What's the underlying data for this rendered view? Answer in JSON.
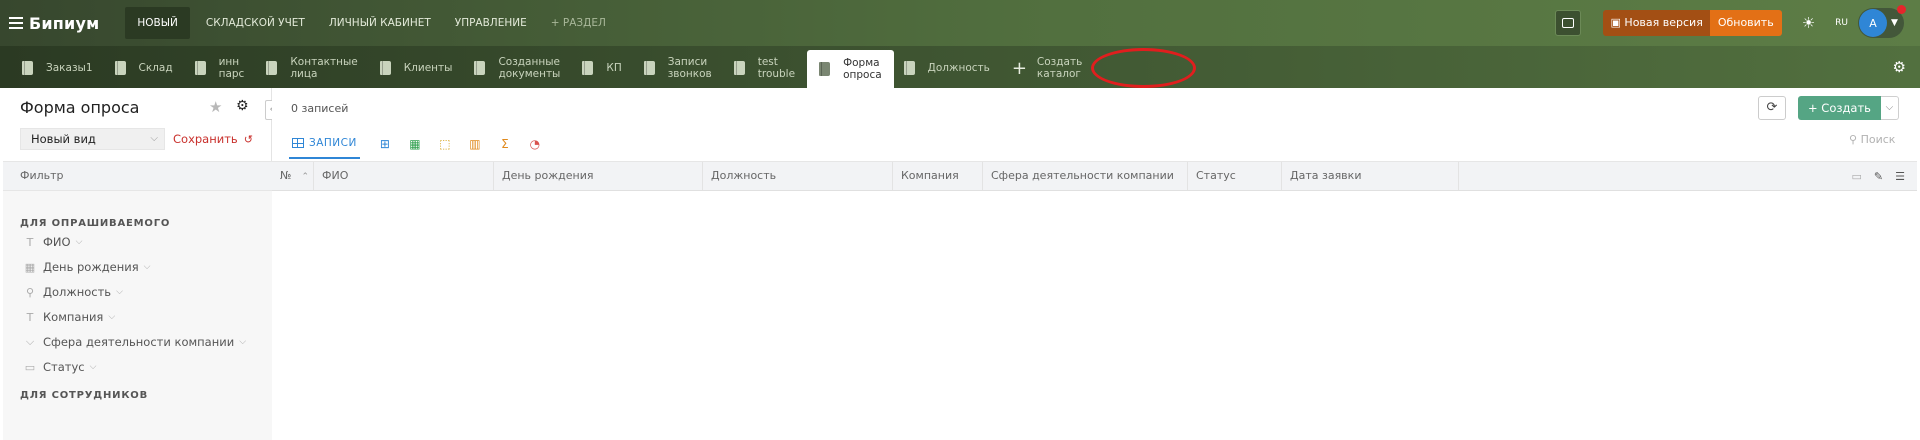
{
  "header": {
    "logo": "Бипиум",
    "nav": [
      "НОВЫЙ",
      "СКЛАДСКОЙ УЧЕТ",
      "ЛИЧНЫЙ КАБИНЕТ",
      "УПРАВЛЕНИЕ",
      "+ РАЗДЕЛ"
    ],
    "new_version_label": "Новая версия",
    "update_label": "Обновить",
    "lang": "RU",
    "avatar_letter": "A"
  },
  "tabs": [
    {
      "label": "Заказы1",
      "icon": "catalog-icon"
    },
    {
      "label": "Склад",
      "icon": "catalog-icon"
    },
    {
      "label": "инн\nпарс",
      "icon": "catalog-icon"
    },
    {
      "label": "Контактные\nлица",
      "icon": "catalog-icon"
    },
    {
      "label": "Клиенты",
      "icon": "catalog-icon"
    },
    {
      "label": "Созданные\nдокументы",
      "icon": "catalog-icon"
    },
    {
      "label": "КП",
      "icon": "catalog-icon"
    },
    {
      "label": "Записи\nзвонков",
      "icon": "catalog-icon"
    },
    {
      "label": "test\ntrouble",
      "icon": "catalog-icon"
    },
    {
      "label": "Форма\nопроса",
      "icon": "catalog-icon",
      "active": true
    },
    {
      "label": "Должность",
      "icon": "catalog-icon"
    }
  ],
  "create_catalog_label": "Создать\nкаталог",
  "left": {
    "title": "Форма опроса",
    "view_select": "Новый вид",
    "save_label": "Сохранить",
    "filter_label": "Фильтр",
    "section1": "ДЛЯ ОПРАШИВАЕМОГО",
    "section2": "ДЛЯ СОТРУДНИКОВ",
    "fields": [
      {
        "label": "ФИО",
        "icon": "text-type-icon"
      },
      {
        "label": "День рождения",
        "icon": "calendar-icon"
      },
      {
        "label": "Должность",
        "icon": "link-icon"
      },
      {
        "label": "Компания",
        "icon": "text-type-icon"
      },
      {
        "label": "Сфера деятельности компании",
        "icon": "dropdown-type-icon"
      },
      {
        "label": "Статус",
        "icon": "status-type-icon"
      }
    ]
  },
  "main": {
    "records_count": "0 записей",
    "records_tab": "ЗАПИСИ",
    "create_label": "Создать",
    "search_placeholder": "Поиск",
    "columns": [
      "№",
      "ФИО",
      "День рождения",
      "Должность",
      "Компания",
      "Сфера деятельности компании",
      "Статус",
      "Дата заявки"
    ]
  },
  "colors": {
    "header_green": "#52703f",
    "accent_blue": "#2f86d6",
    "create_green": "#55a584",
    "save_red": "#c9302c",
    "update_orange": "#e37016"
  }
}
